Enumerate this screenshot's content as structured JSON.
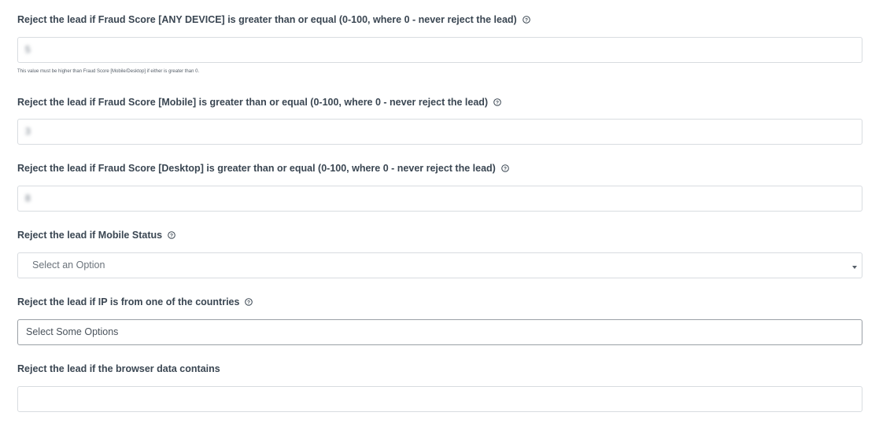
{
  "fields": {
    "fraud_any": {
      "label": "Reject the lead if Fraud Score [ANY DEVICE] is greater than or equal (0-100, where 0 - never reject the lead)",
      "value": "5",
      "hint": "This value must be higher than Fraud Score [Mobile/Desktop] if either is greater than 0."
    },
    "fraud_mobile": {
      "label": "Reject the lead if Fraud Score [Mobile] is greater than or equal (0-100, where 0 - never reject the lead)",
      "value": "3"
    },
    "fraud_desktop": {
      "label": "Reject the lead if Fraud Score [Desktop] is greater than or equal (0-100, where 0 - never reject the lead)",
      "value": "8"
    },
    "mobile_status": {
      "label": "Reject the lead if Mobile Status",
      "placeholder": "Select an Option"
    },
    "ip_countries": {
      "label": "Reject the lead if IP is from one of the countries",
      "placeholder": "Select Some Options"
    },
    "browser_data": {
      "label": "Reject the lead if the browser data contains",
      "value": ""
    }
  },
  "icons": {
    "help": "question-circle-icon",
    "caret": "chevron-down-icon"
  },
  "colors": {
    "label_text": "#3a4652",
    "input_border": "#d8dce0",
    "focused_border": "#9aa0a6"
  }
}
